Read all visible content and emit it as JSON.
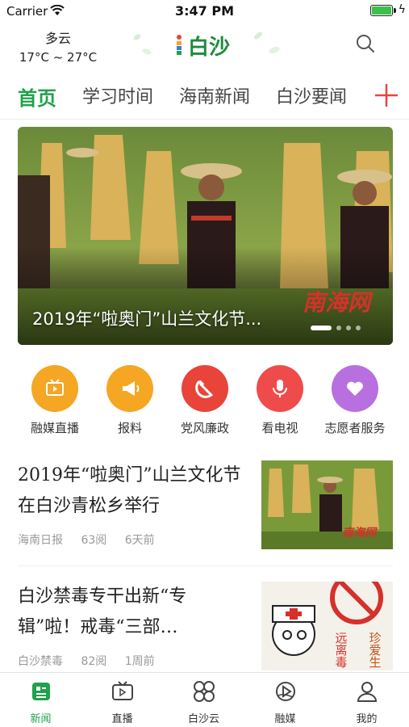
{
  "status_bar": {
    "carrier": "Carrier",
    "time": "3:47 PM",
    "battery_level": 1.0
  },
  "header": {
    "weather_condition": "多云",
    "weather_temp": "17°C ~ 27°C",
    "logo_text": "白沙",
    "search_icon": "search-icon"
  },
  "tabs": [
    {
      "label": "首页",
      "active": true
    },
    {
      "label": "学习时间"
    },
    {
      "label": "海南新闻"
    },
    {
      "label": "白沙要闻"
    }
  ],
  "banner": {
    "caption": "2019年“啦奥门”山兰文化节...",
    "watermark": "南海网",
    "slides": 4,
    "active_slide": 0
  },
  "quick_links": [
    {
      "label": "融媒直播",
      "icon": "tv-icon",
      "color": "#f5a623"
    },
    {
      "label": "报料",
      "icon": "megaphone-icon",
      "color": "#f5a623"
    },
    {
      "label": "党风廉政",
      "icon": "hammer-sickle-icon",
      "color": "#e8443a"
    },
    {
      "label": "看电视",
      "icon": "microphone-icon",
      "color": "#ef4b4b"
    },
    {
      "label": "志愿者服务",
      "icon": "heart-icon",
      "color": "#b86fe0"
    }
  ],
  "news": [
    {
      "title": "2019年“啦奥门”山兰文化节在白沙青松乡举行",
      "source": "海南日报",
      "views": "63阅",
      "time": "6天前"
    },
    {
      "title": "白沙禁毒专干出新“专辑”啦！戒毒“三部…",
      "source": "白沙禁毒",
      "views": "82阅",
      "time": "1周前",
      "thumb_text_1": "远离毒",
      "thumb_text_2": "珍爱生"
    }
  ],
  "tabbar": [
    {
      "label": "新闻",
      "icon": "news-icon",
      "active": true
    },
    {
      "label": "直播",
      "icon": "live-tv-icon"
    },
    {
      "label": "白沙云",
      "icon": "cloud-grid-icon"
    },
    {
      "label": "融媒",
      "icon": "media-icon"
    },
    {
      "label": "我的",
      "icon": "profile-icon"
    }
  ],
  "colors": {
    "accent": "#20a14a",
    "plus": "#e8443a"
  }
}
